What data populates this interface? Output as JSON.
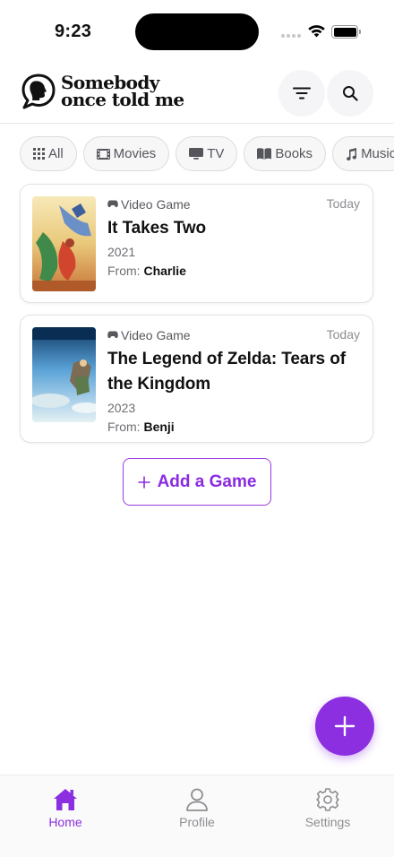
{
  "status_bar": {
    "time": "9:23"
  },
  "header": {
    "logo_line1": "Somebody",
    "logo_line2": "once told me"
  },
  "categories": [
    {
      "label": "All",
      "icon": "grid-icon"
    },
    {
      "label": "Movies",
      "icon": "film-icon"
    },
    {
      "label": "TV",
      "icon": "tv-icon"
    },
    {
      "label": "Books",
      "icon": "book-icon"
    },
    {
      "label": "Music",
      "icon": "music-note-icon"
    }
  ],
  "recommendations": [
    {
      "type": "Video Game",
      "date": "Today",
      "title": "It Takes Two",
      "year": "2021",
      "from_label": "From:",
      "from": "Charlie"
    },
    {
      "type": "Video Game",
      "date": "Today",
      "title": "The Legend of Zelda: Tears of the Kingdom",
      "year": "2023",
      "from_label": "From:",
      "from": "Benji"
    }
  ],
  "add_button": {
    "label": "Add a Game"
  },
  "tabs": [
    {
      "label": "Home",
      "active": true
    },
    {
      "label": "Profile",
      "active": false
    },
    {
      "label": "Settings",
      "active": false
    }
  ],
  "colors": {
    "accent": "#8b2fe0",
    "text": "#111111",
    "muted": "#8e8e93"
  }
}
